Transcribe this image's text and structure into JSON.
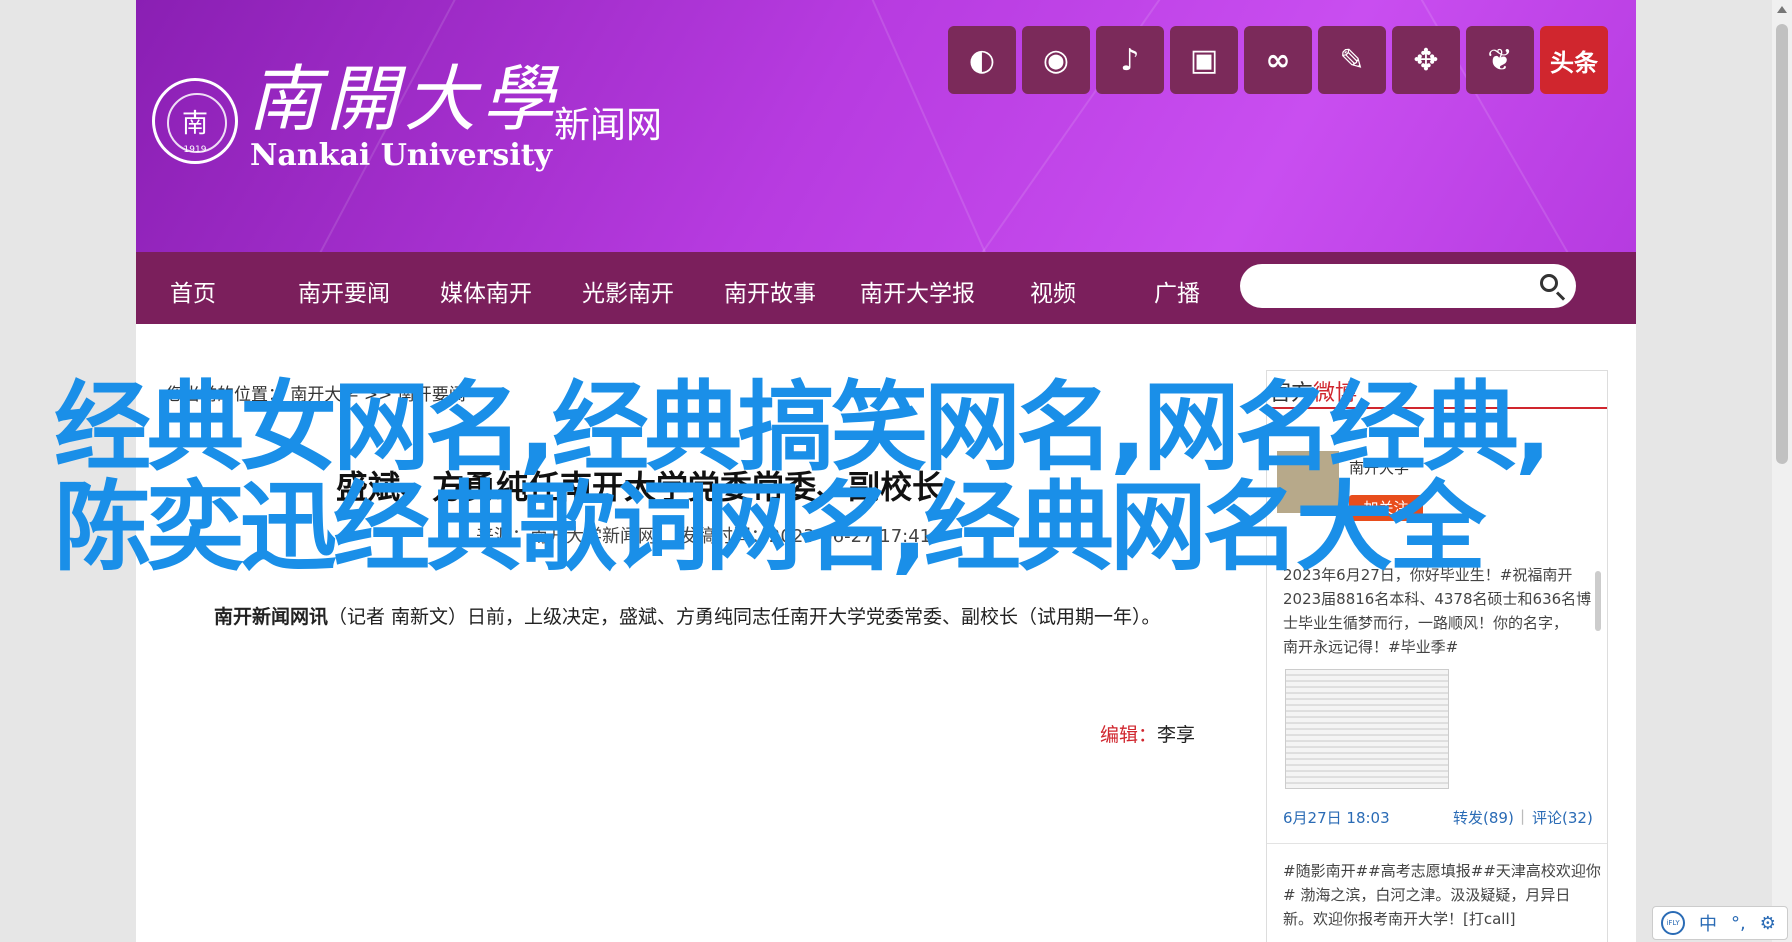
{
  "banner": {
    "logo_cn": "南開大學",
    "logo_en": "Nankai University",
    "subtitle": "新闻网",
    "seal_year": "1919",
    "social_icons": [
      "wechat-icon",
      "weibo-icon",
      "douyin-icon",
      "bilibili-icon",
      "kuaishou-icon",
      "xuexi-icon",
      "qq-icon",
      "feather-icon",
      "toutiao-icon"
    ],
    "toutiao_label": "头条"
  },
  "nav": {
    "items": [
      "首页",
      "南开要闻",
      "媒体南开",
      "光影南开",
      "南开故事",
      "南开大学报",
      "视频",
      "广播"
    ],
    "search_placeholder": ""
  },
  "breadcrumb": {
    "prefix": "您当前的位置：",
    "crumb1": "南开大学",
    "sep": ">>",
    "crumb2": "南开要闻"
  },
  "article": {
    "title": "盛斌、方勇纯任南开大学党委常委、副校长",
    "meta_source": "来源：南开大学新闻网",
    "meta_time": "发稿时间：2023-06-27 17:41",
    "para_lead": "南开新闻网讯",
    "para_body": "（记者 南新文）日前，上级决定，盛斌、方勇纯同志任南开大学党委常委、副校长（试用期一年）。",
    "editor_label": "编辑：",
    "editor_name": "李享"
  },
  "weibo": {
    "head_a": "官方",
    "head_b": "微博",
    "name": "南开大学",
    "follow": "加关注",
    "post_lines": [
      "2023年6月27日，你好毕业生！#祝福南开",
      "2023届8816名本科、4378名硕士和636名博",
      "士毕业生循梦而行，一路顺风！你的名字，",
      "南开永远记得！#毕业季#"
    ],
    "time": "6月27日 18:03",
    "repost": "转发(89)",
    "sep": "|",
    "comment": "评论(32)",
    "post2_lines": [
      "#随影南开##高考志愿填报##天津高校欢迎你",
      "# 渤海之滨，白河之津。汲汲疑疑，月异日",
      "新。欢迎你报考南开大学！[打call]"
    ]
  },
  "overlay": {
    "text": "经典女网名,经典搞笑网名,网名经典,陈奕迅经典歌词网名,经典网名大全"
  },
  "tray": {
    "ifly": "iFLY",
    "lang": "中",
    "dot": "°,"
  }
}
